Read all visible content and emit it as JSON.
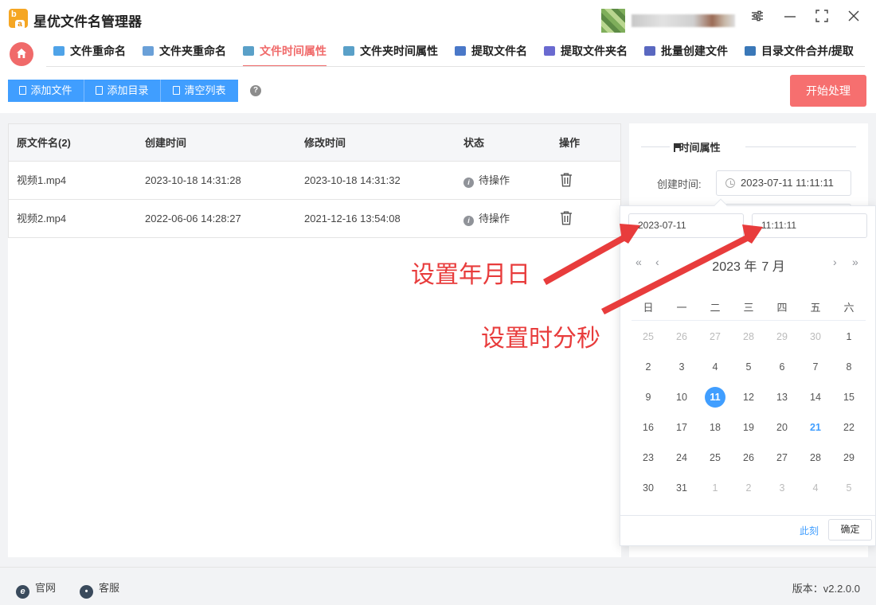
{
  "app": {
    "title": "星优文件名管理器"
  },
  "nav": {
    "tabs": [
      {
        "label": "文件重命名",
        "icon": "rename-file-icon",
        "color": "#4fa3e8"
      },
      {
        "label": "文件夹重命名",
        "icon": "rename-folder-icon",
        "color": "#6aa0d8"
      },
      {
        "label": "文件时间属性",
        "icon": "file-time-icon",
        "color": "#5aa0c8"
      },
      {
        "label": "文件夹时间属性",
        "icon": "folder-time-icon",
        "color": "#5aa0c8"
      },
      {
        "label": "提取文件名",
        "icon": "extract-filename-icon",
        "color": "#4a78c8"
      },
      {
        "label": "提取文件夹名",
        "icon": "extract-foldername-icon",
        "color": "#6a6ad0"
      },
      {
        "label": "批量创建文件",
        "icon": "batch-create-icon",
        "color": "#5a68c0"
      },
      {
        "label": "目录文件合并/提取",
        "icon": "merge-extract-icon",
        "color": "#3a78b8"
      }
    ],
    "active_index": 2
  },
  "toolbar": {
    "add_file": "添加文件",
    "add_dir": "添加目录",
    "clear_list": "清空列表",
    "help": "?",
    "start": "开始处理"
  },
  "table": {
    "headers": [
      "原文件名(2)",
      "创建时间",
      "修改时间",
      "状态",
      "操作"
    ],
    "rows": [
      {
        "name": "视频1.mp4",
        "created": "2023-10-18 14:31:28",
        "modified": "2023-10-18 14:31:32",
        "status": "待操作"
      },
      {
        "name": "视频2.mp4",
        "created": "2022-06-06 14:28:27",
        "modified": "2021-12-16 13:54:08",
        "status": "待操作"
      }
    ]
  },
  "panel": {
    "section_title": "时间属性",
    "create_label": "创建时间:",
    "create_value": "2023-07-11 11:11:11"
  },
  "picker": {
    "date_value": "2023-07-11",
    "time_value": "11:11:11",
    "year_label": "2023 年",
    "month_label": "7 月",
    "weekdays": [
      "日",
      "一",
      "二",
      "三",
      "四",
      "五",
      "六"
    ],
    "weeks": [
      [
        "25",
        "26",
        "27",
        "28",
        "29",
        "30",
        "1"
      ],
      [
        "2",
        "3",
        "4",
        "5",
        "6",
        "7",
        "8"
      ],
      [
        "9",
        "10",
        "11",
        "12",
        "13",
        "14",
        "15"
      ],
      [
        "16",
        "17",
        "18",
        "19",
        "20",
        "21",
        "22"
      ],
      [
        "23",
        "24",
        "25",
        "26",
        "27",
        "28",
        "29"
      ],
      [
        "30",
        "31",
        "1",
        "2",
        "3",
        "4",
        "5"
      ]
    ],
    "selected_day": "11",
    "today_day": "21",
    "now": "此刻",
    "ok": "确定"
  },
  "annotations": {
    "date_note": "设置年月日",
    "time_note": "设置时分秒",
    "color": "#e83c3c"
  },
  "footer": {
    "website": "官网",
    "support": "客服",
    "version": "版本：v2.2.0.0"
  }
}
